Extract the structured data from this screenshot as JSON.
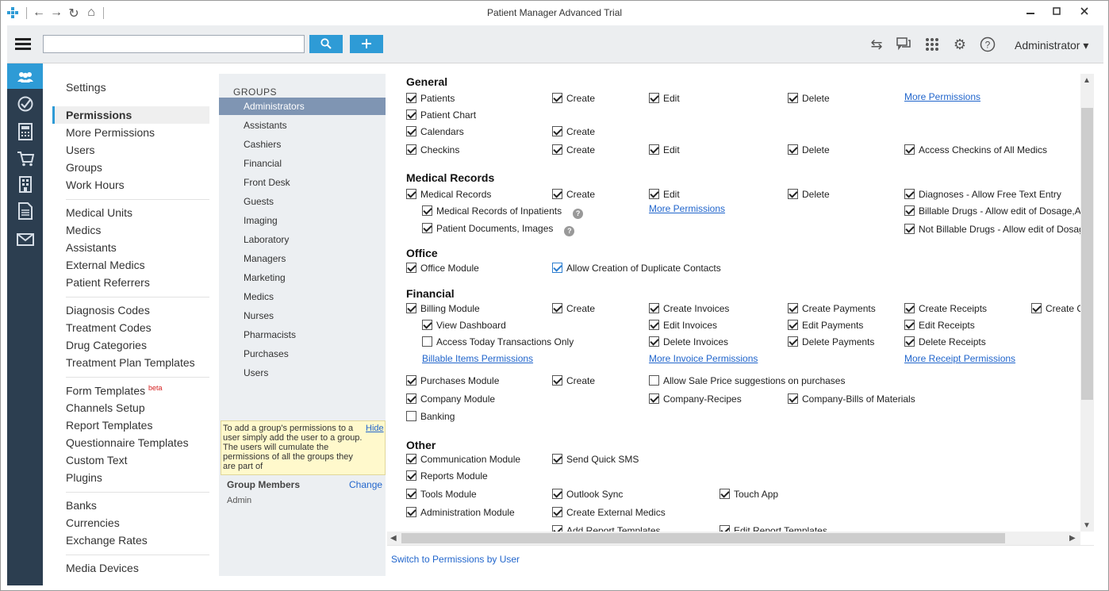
{
  "window": {
    "title": "Patient Manager Advanced Trial",
    "minimize": "▭",
    "maximize": "◻",
    "close": "✕"
  },
  "toolbar": {
    "search_placeholder": "",
    "search_button_icon": "search-icon",
    "add_button_icon": "plus-icon",
    "admin_label": "Administrator ▾",
    "icons": [
      "transfer-icon",
      "chat-icon",
      "apps-grid-icon",
      "gear-icon",
      "help-icon"
    ]
  },
  "iconbar": [
    "users-icon",
    "check-circle-icon",
    "calculator-icon",
    "cart-icon",
    "building-icon",
    "document-icon",
    "mail-icon"
  ],
  "settings_nav": {
    "settings": "Settings",
    "permissions": "Permissions",
    "more_permissions": "More Permissions",
    "users": "Users",
    "groups": "Groups",
    "work_hours": "Work Hours",
    "medical_units": "Medical Units",
    "medics": "Medics",
    "assistants": "Assistants",
    "external_medics": "External Medics",
    "patient_referrers": "Patient Referrers",
    "diagnosis_codes": "Diagnosis Codes",
    "treatment_codes": "Treatment Codes",
    "drug_categories": "Drug Categories",
    "treatment_plan_templates": "Treatment Plan Templates",
    "form_templates": "Form Templates",
    "beta": "beta",
    "channels_setup": "Channels Setup",
    "report_templates": "Report Templates",
    "questionnaire_templates": "Questionnaire Templates",
    "custom_text": "Custom Text",
    "plugins": "Plugins",
    "banks": "Banks",
    "currencies": "Currencies",
    "exchange_rates": "Exchange Rates",
    "media_devices": "Media Devices"
  },
  "groups": {
    "heading": "GROUPS",
    "items": [
      "Administrators",
      "Assistants",
      "Cashiers",
      "Financial",
      "Front Desk",
      "Guests",
      "Imaging",
      "Laboratory",
      "Managers",
      "Marketing",
      "Medics",
      "Nurses",
      "Pharmacists",
      "Purchases",
      "Users"
    ],
    "hint": "To add a group's permissions to a user simply add the user to a group. The users will cumulate the permissions of all the groups they are part of",
    "hide": "Hide",
    "members_title": "Group Members",
    "change": "Change",
    "member": "Admin"
  },
  "permissions": {
    "general": "General",
    "patients": "Patients",
    "create": "Create",
    "edit": "Edit",
    "delete": "Delete",
    "more_permissions": "More Permissions",
    "patient_chart": "Patient Chart",
    "calendars": "Calendars",
    "checkins": "Checkins",
    "access_checkins": "Access Checkins of All Medics",
    "medical_records_title": "Medical Records",
    "medical_records": "Medical Records",
    "diagnoses_free": "Diagnoses - Allow Free Text Entry",
    "mr_inpatients": "Medical Records of Inpatients",
    "billable_drugs": "Billable Drugs - Allow edit of Dosage,Adm",
    "patient_documents": "Patient Documents, Images",
    "not_billable_drugs": "Not Billable Drugs - Allow edit of Dosage,",
    "office_title": "Office",
    "office_module": "Office Module",
    "allow_duplicate": "Allow Creation of Duplicate Contacts",
    "financial_title": "Financial",
    "billing_module": "Billing Module",
    "create_invoices": "Create Invoices",
    "create_payments": "Create Payments",
    "create_receipts": "Create Receipts",
    "create_c": "Create C",
    "view_dashboard": "View Dashboard",
    "edit_invoices": "Edit Invoices",
    "edit_payments": "Edit Payments",
    "edit_receipts": "Edit Receipts",
    "access_today": "Access Today Transactions Only",
    "delete_invoices": "Delete Invoices",
    "delete_payments": "Delete Payments",
    "delete_receipts": "Delete Receipts",
    "billable_items_perm": "Billable Items Permissions",
    "more_invoice_perm": "More Invoice Permissions",
    "more_receipt_perm": "More Receipt Permissions",
    "purchases_module": "Purchases Module",
    "allow_sale_price": "Allow Sale Price suggestions on purchases",
    "company_module": "Company Module",
    "company_recipes": "Company-Recipes",
    "company_bills": "Company-Bills of Materials",
    "banking": "Banking",
    "other_title": "Other",
    "communication_module": "Communication Module",
    "send_quick_sms": "Send Quick SMS",
    "reports_module": "Reports Module",
    "tools_module": "Tools Module",
    "outlook_sync": "Outlook Sync",
    "touch_app": "Touch App",
    "administration_module": "Administration Module",
    "create_external_medics": "Create External Medics",
    "add_report_templates": "Add Report Templates",
    "edit_report_templates": "Edit Report Templates",
    "help_q": "?"
  },
  "footer": {
    "switch_link": "Switch to Permissions by User"
  }
}
